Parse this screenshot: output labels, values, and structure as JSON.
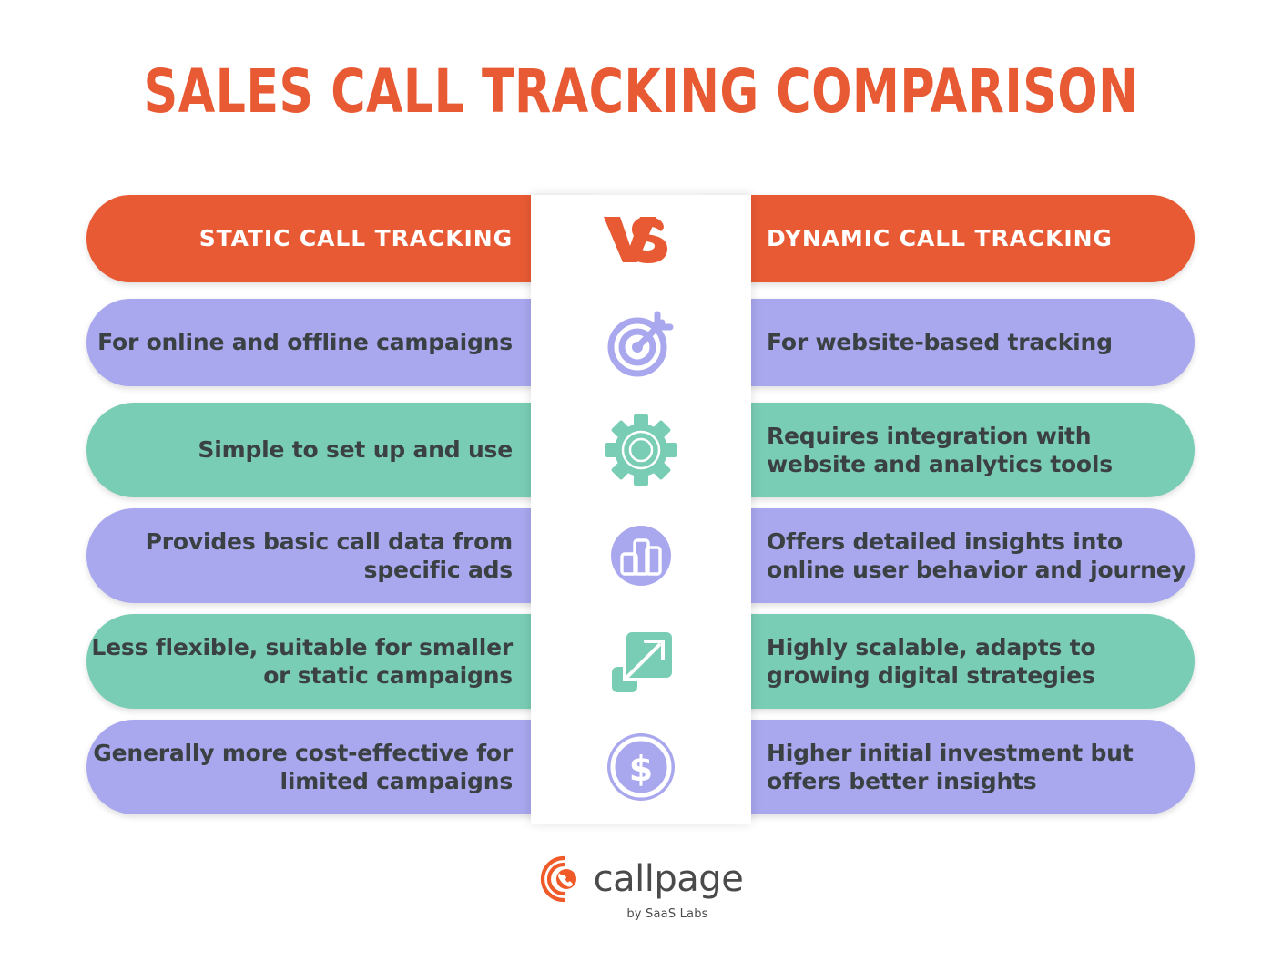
{
  "page": {
    "title": "SALES CALL TRACKING COMPARISON",
    "background": "#FFFFFF"
  },
  "colors": {
    "orange": "#E85A33",
    "purple": "#A9A7EE",
    "green": "#79CDB4",
    "text_dark": "#3B4043",
    "text_light": "#FFFFFF",
    "logo_gray": "#4A4A4A"
  },
  "columns": {
    "left_header": "STATIC CALL TRACKING",
    "right_header": "DYNAMIC CALL TRACKING",
    "divider_label": "VS"
  },
  "rows": [
    {
      "icon": "vs-icon",
      "color": "#E85A33",
      "color_name": "orange",
      "left": "STATIC CALL TRACKING",
      "right": "DYNAMIC CALL TRACKING",
      "is_header": true
    },
    {
      "icon": "target-icon",
      "color": "#A9A7EE",
      "color_name": "purple",
      "left": "For online and offline campaigns",
      "right": "For website-based tracking",
      "is_header": false
    },
    {
      "icon": "gear-icon",
      "color": "#79CDB4",
      "color_name": "green",
      "left": "Simple to set up and use",
      "right": "Requires integration with website and analytics tools",
      "is_header": false
    },
    {
      "icon": "bar-chart-icon",
      "color": "#A9A7EE",
      "color_name": "purple",
      "left": "Provides basic call data from specific ads",
      "right": "Offers detailed insights into online user behavior and journey",
      "is_header": false
    },
    {
      "icon": "scale-arrow-icon",
      "color": "#79CDB4",
      "color_name": "green",
      "left": "Less flexible, suitable for smaller or static campaigns",
      "right": "Highly scalable, adapts to growing digital strategies",
      "is_header": false
    },
    {
      "icon": "dollar-coin-icon",
      "color": "#A9A7EE",
      "color_name": "purple",
      "left": "Generally more cost-effective for limited campaigns",
      "right": "Higher initial investment but offers better insights",
      "is_header": false
    }
  ],
  "footer": {
    "logo_mark": "callpage-logo-icon",
    "logo_word": "callpage",
    "logo_tagline": "by SaaS Labs"
  }
}
